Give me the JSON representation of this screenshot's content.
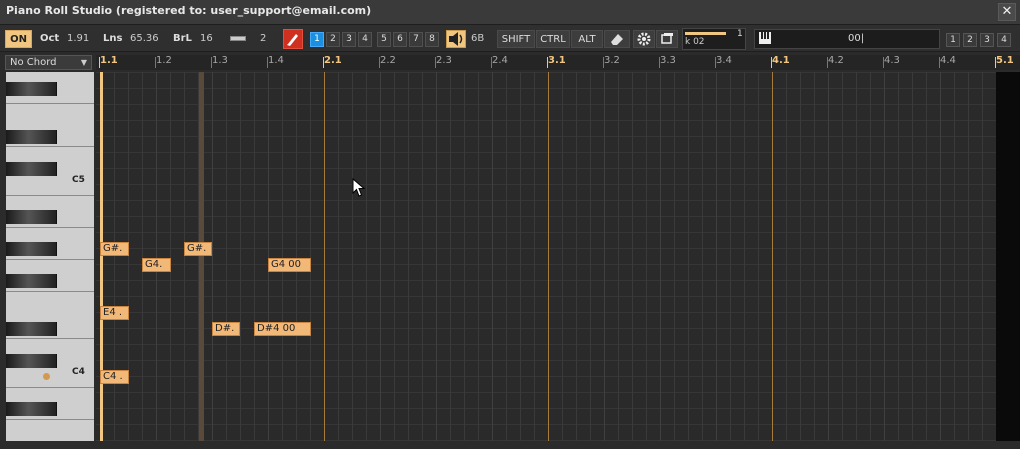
{
  "window": {
    "title": "Piano Roll Studio  (registered to: user_support@email.com)",
    "close_glyph": "✕"
  },
  "toolbar": {
    "on_label": "ON",
    "oct_label": "Oct",
    "oct_value": "1.91",
    "lns_label": "Lns",
    "lns_value": "65.36",
    "brl_label": "BrL",
    "brl_value": "16",
    "step_value": "2",
    "tracks": [
      "1",
      "2",
      "3",
      "4",
      "5",
      "6",
      "7",
      "8"
    ],
    "active_track": "1",
    "volume_value": "6B",
    "shift_label": "SHIFT",
    "ctrl_label": "CTRL",
    "alt_label": "ALT",
    "slider_label": "k 02",
    "slider_value": "1",
    "slider_level": 0.85,
    "time_value": "00|",
    "views": [
      "1",
      "2",
      "3",
      "4"
    ]
  },
  "chord": {
    "selected": "No Chord"
  },
  "keyboard": {
    "c5_label": "C5",
    "c4_label": "C4"
  },
  "ruler": {
    "ticks": [
      "1.1",
      "1.2",
      "1.3",
      "1.4",
      "2.1",
      "2.2",
      "2.3",
      "2.4",
      "3.1",
      "3.2",
      "3.3",
      "3.4",
      "4.1",
      "4.2",
      "4.3",
      "4.4",
      "5.1"
    ]
  },
  "notes": [
    {
      "label": "G#."
    },
    {
      "label": "G4."
    },
    {
      "label": "G#."
    },
    {
      "label": "G4 00"
    },
    {
      "label": "E4 ."
    },
    {
      "label": "D#."
    },
    {
      "label": "D#4 00"
    },
    {
      "label": "C4 ."
    }
  ],
  "colors": {
    "accent": "#f0c680",
    "note_fill": "#f2b878",
    "active_track": "#1a90e0",
    "pencil": "#d03020"
  },
  "icons": [
    "close-icon",
    "step-icon",
    "pencil-icon",
    "speaker-icon",
    "eraser-icon",
    "gear-icon",
    "window-icon",
    "piano-icon",
    "chevron-down-icon",
    "mouse-cursor-icon"
  ]
}
